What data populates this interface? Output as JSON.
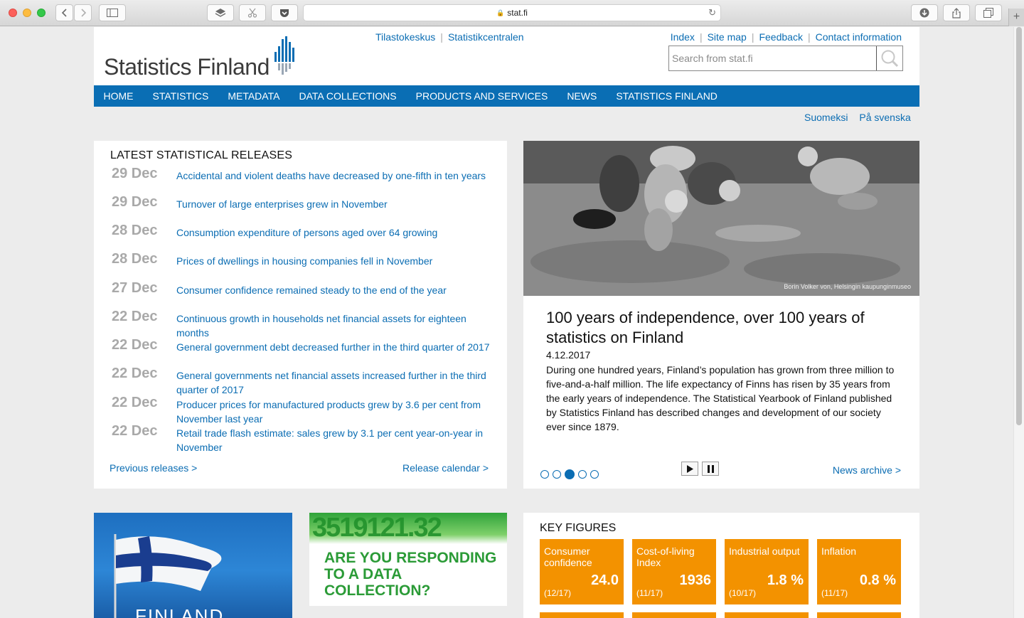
{
  "browser": {
    "url": "stat.fi"
  },
  "header": {
    "logo": "Statistics Finland",
    "top_links_left": [
      "Tilastokeskus",
      "Statistikcentralen"
    ],
    "top_links_right": [
      "Index",
      "Site map",
      "Feedback",
      "Contact information"
    ],
    "search_placeholder": "Search from stat.fi"
  },
  "nav": {
    "items": [
      "HOME",
      "STATISTICS",
      "METADATA",
      "DATA COLLECTIONS",
      "PRODUCTS AND SERVICES",
      "NEWS",
      "STATISTICS FINLAND"
    ]
  },
  "languages": [
    "Suomeksi",
    "På svenska"
  ],
  "releases": {
    "heading": "LATEST STATISTICAL RELEASES",
    "items": [
      {
        "date": "29 Dec",
        "title": "Accidental and violent deaths have decreased by one-fifth in ten years"
      },
      {
        "date": "29 Dec",
        "title": "Turnover of large enterprises grew in November"
      },
      {
        "date": "28 Dec",
        "title": "Consumption expenditure of persons aged over 64 growing"
      },
      {
        "date": "28 Dec",
        "title": "Prices of dwellings in housing companies fell in November"
      },
      {
        "date": "27 Dec",
        "title": "Consumer confidence remained steady to the end of the year"
      },
      {
        "date": "22 Dec",
        "title": "Continuous growth in households net financial assets for eighteen months"
      },
      {
        "date": "22 Dec",
        "title": "General government debt decreased further in the third quarter of 2017"
      },
      {
        "date": "22 Dec",
        "title": "General governments net financial assets increased further in the third quarter of 2017"
      },
      {
        "date": "22 Dec",
        "title": "Producer prices for manufactured products grew by 3.6 per cent from November last year"
      },
      {
        "date": "22 Dec",
        "title": "Retail trade flash estimate: sales grew by 3.1 per cent year-on-year in November"
      }
    ],
    "previous_link": "Previous releases >",
    "calendar_link": "Release calendar >"
  },
  "feature": {
    "photo_credit": "Borin Volker von, Helsingin kaupunginmuseo",
    "title": "100 years of independence, over 100 years of statistics on Finland",
    "date": "4.12.2017",
    "body": "During one hundred years, Finland’s population has grown from three million to five-and-a-half million. The life expectancy of Finns has risen by 35 years from the early years of independence. The Statistical Yearbook of Finland published by Statistics Finland has described changes and development of our society ever since 1879.",
    "active_slide": 3,
    "slide_count": 5,
    "news_archive_link": "News archive >"
  },
  "banners": {
    "flag_text": "FINLAND",
    "collect_digits": "3519121.32",
    "collect_text": "ARE YOU RESPONDING TO A DATA COLLECTION?"
  },
  "key_figures": {
    "heading": "KEY FIGURES",
    "items": [
      {
        "label": "Consumer confidence",
        "value": "24.0",
        "period": "(12/17)"
      },
      {
        "label": "Cost-of-living Index",
        "value": "1936",
        "period": "(11/17)"
      },
      {
        "label": "Industrial output",
        "value": "1.8 %",
        "period": "(10/17)"
      },
      {
        "label": "Inflation",
        "value": "0.8 %",
        "period": "(11/17)"
      }
    ]
  },
  "colors": {
    "brand_blue": "#0a6eb4",
    "link_blue": "#0b6db3",
    "key_figure_orange": "#f39200",
    "collection_green": "#2b9b37"
  }
}
